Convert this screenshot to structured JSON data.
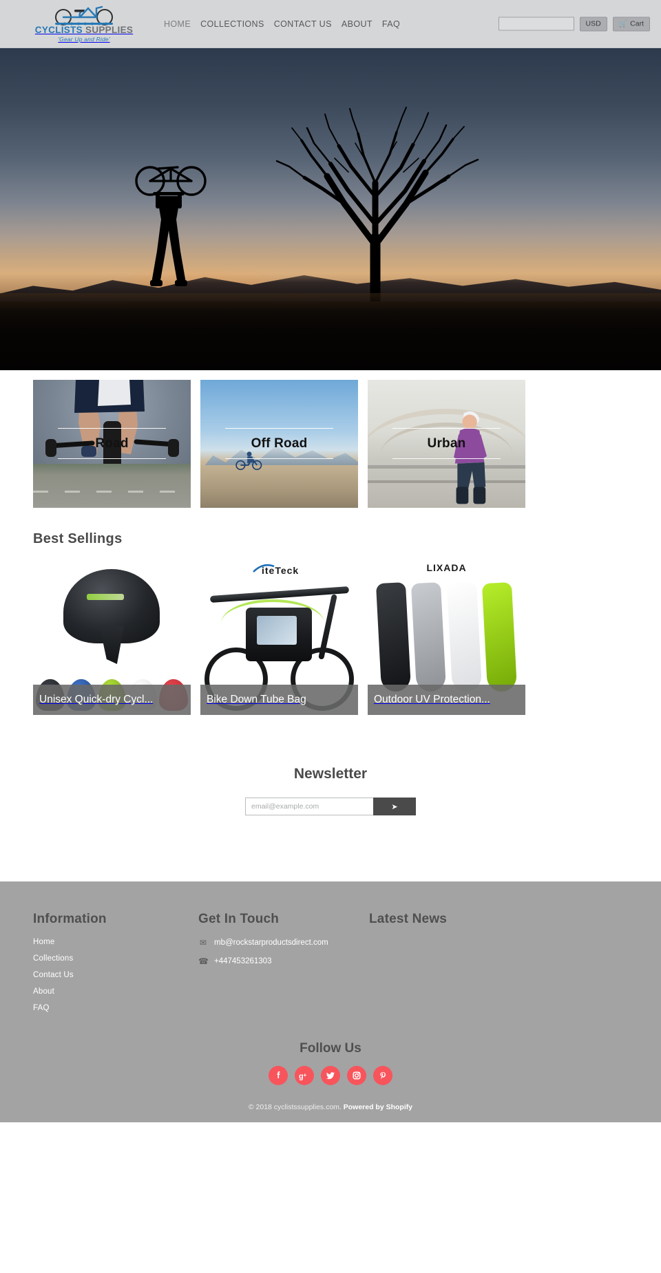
{
  "header": {
    "logo": {
      "brand_part1": "CYCLISTS",
      "brand_part2": "SUPPLIES",
      "tagline": "'Gear Up and Ride'",
      "icon": "bicycle-icon"
    },
    "nav": [
      {
        "label": "HOME"
      },
      {
        "label": "COLLECTIONS"
      },
      {
        "label": "CONTACT US"
      },
      {
        "label": "ABOUT"
      },
      {
        "label": "FAQ"
      }
    ],
    "search_placeholder": "",
    "search_value": "",
    "currency": "USD",
    "cart_label": "Cart",
    "cart_icon": "shopping-cart-icon",
    "background_color": "#d5d6d8"
  },
  "hero": {
    "alt": "Cyclist holding bicycle overhead silhouetted against sunset with large bare tree"
  },
  "categories": [
    {
      "label": "Road"
    },
    {
      "label": "Off Road"
    },
    {
      "label": "Urban"
    }
  ],
  "best_sellings": {
    "title": "Best Sellings",
    "products": [
      {
        "title": "Unisex Quick-dry Cycl...",
        "brand": ""
      },
      {
        "title": "Bike Down Tube Bag",
        "brand": "LiteTeck"
      },
      {
        "title": "Outdoor UV Protection...",
        "brand": "LIXADA"
      }
    ]
  },
  "newsletter": {
    "title": "Newsletter",
    "placeholder": "email@example.com",
    "value": "",
    "submit_icon": "➤"
  },
  "footer": {
    "information": {
      "heading": "Information",
      "links": [
        {
          "label": "Home"
        },
        {
          "label": "Collections"
        },
        {
          "label": "Contact Us"
        },
        {
          "label": "About"
        },
        {
          "label": "FAQ"
        }
      ]
    },
    "get_in_touch": {
      "heading": "Get In Touch",
      "email": "mb@rockstarproductsdirect.com",
      "email_icon": "envelope-icon",
      "phone": "+447453261303",
      "phone_icon": "phone-icon"
    },
    "latest_news": {
      "heading": "Latest News",
      "items": []
    },
    "follow": {
      "heading": "Follow Us",
      "accent_color": "#f8545c",
      "socials": [
        {
          "name": "facebook-icon",
          "glyph": "f"
        },
        {
          "name": "google-plus-icon",
          "glyph": "g+"
        },
        {
          "name": "twitter-icon",
          "glyph": "t"
        },
        {
          "name": "instagram-icon",
          "glyph": "i"
        },
        {
          "name": "pinterest-icon",
          "glyph": "p"
        }
      ]
    },
    "copyright_prefix": "© 2018 cyclistssupplies.com. ",
    "copyright_powered": "Powered by Shopify",
    "background_color": "#a3a3a3"
  }
}
